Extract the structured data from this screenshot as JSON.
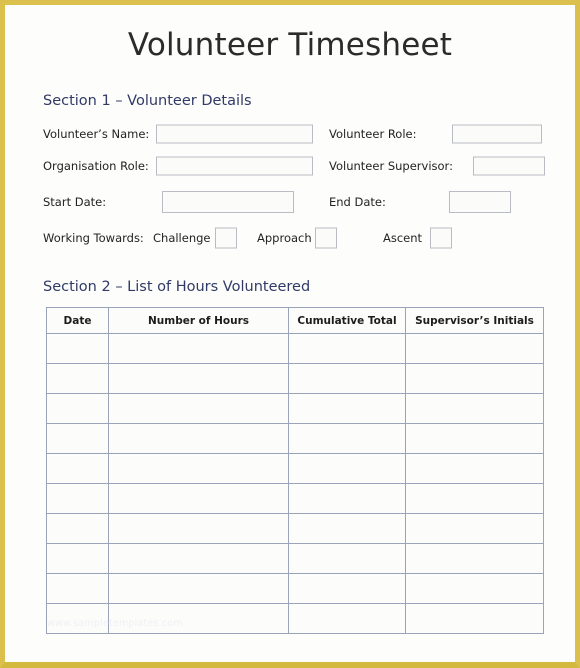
{
  "document": {
    "title": "Volunteer Timesheet",
    "border_color": "#dcc04d",
    "page_background": "#fdfdfb",
    "heading_color": "#313a66",
    "field_border_color": "#b9bcc4",
    "table_border_color": "#9aa4b8",
    "watermark": "www.sampletemplates.com"
  },
  "section1": {
    "heading": "Section 1 – Volunteer Details",
    "fields": [
      {
        "label": "Volunteer’s Name:",
        "value": "",
        "placeholder": ""
      },
      {
        "label": "Volunteer Role:",
        "value": "",
        "placeholder": ""
      },
      {
        "label": "Organisation Role:",
        "value": "",
        "placeholder": ""
      },
      {
        "label": "Volunteer Supervisor:",
        "value": "",
        "placeholder": ""
      },
      {
        "label": "Start Date:",
        "value": "",
        "placeholder": ""
      },
      {
        "label": "End Date:",
        "value": "",
        "placeholder": ""
      }
    ],
    "working_towards": {
      "label": "Working Towards:",
      "options": [
        {
          "label": "Challenge",
          "checked": false
        },
        {
          "label": "Approach",
          "checked": false
        },
        {
          "label": "Ascent",
          "checked": false
        }
      ]
    }
  },
  "section2": {
    "heading": "Section 2 – List of Hours Volunteered",
    "table": {
      "columns": [
        "Date",
        "Number of Hours",
        "Cumulative Total",
        "Supervisor’s Initials"
      ],
      "rows": [
        [
          "",
          "",
          "",
          ""
        ],
        [
          "",
          "",
          "",
          ""
        ],
        [
          "",
          "",
          "",
          ""
        ],
        [
          "",
          "",
          "",
          ""
        ],
        [
          "",
          "",
          "",
          ""
        ],
        [
          "",
          "",
          "",
          ""
        ],
        [
          "",
          "",
          "",
          ""
        ],
        [
          "",
          "",
          "",
          ""
        ],
        [
          "",
          "",
          "",
          ""
        ],
        [
          "",
          "",
          "",
          ""
        ]
      ]
    }
  }
}
